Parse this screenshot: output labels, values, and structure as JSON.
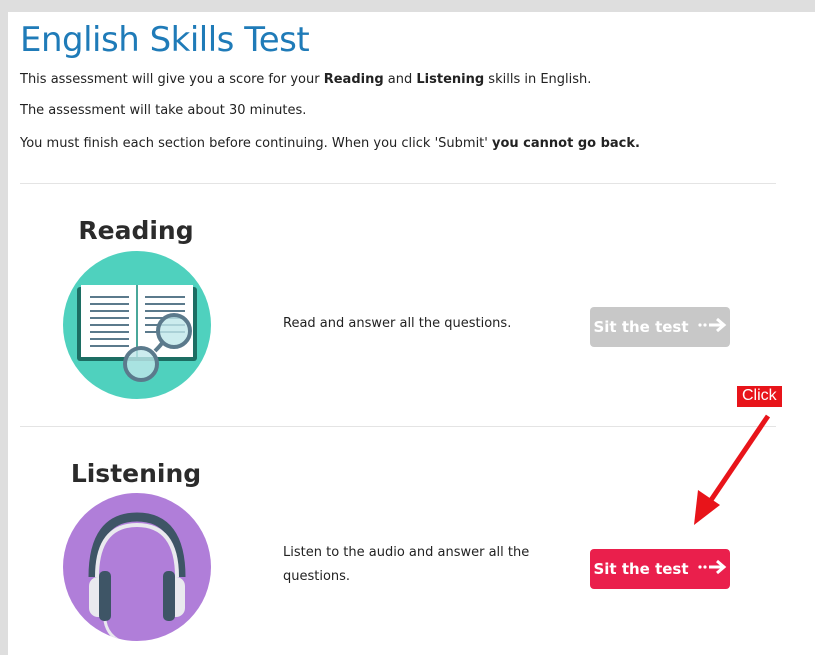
{
  "page": {
    "title": "English Skills Test",
    "intro": {
      "line1_pre": "This assessment will give you a score for your ",
      "line1_bold1": "Reading",
      "line1_mid": " and ",
      "line1_bold2": "Listening",
      "line1_post": " skills in English.",
      "line2": "The assessment will take about 30 minutes.",
      "line3_pre": "You must finish each section before continuing. When you click 'Submit' ",
      "line3_bold": "you cannot go back."
    }
  },
  "sections": [
    {
      "title": "Reading",
      "icon": "open-book-glasses-icon",
      "description": "Read and answer all the questions.",
      "button_label": "Sit the test",
      "button_state": "disabled"
    },
    {
      "title": "Listening",
      "icon": "headphones-icon",
      "description": "Listen to the audio and answer all the questions.",
      "button_label": "Sit the test",
      "button_state": "enabled"
    }
  ],
  "annotation": {
    "label": "Click"
  },
  "colors": {
    "title": "#1f7bb8",
    "reading_circle": "#4fd1be",
    "listening_circle": "#b07ed9",
    "button_active": "#ea1f4c",
    "button_disabled": "#c8c8c8",
    "annotation": "#e8141a"
  }
}
